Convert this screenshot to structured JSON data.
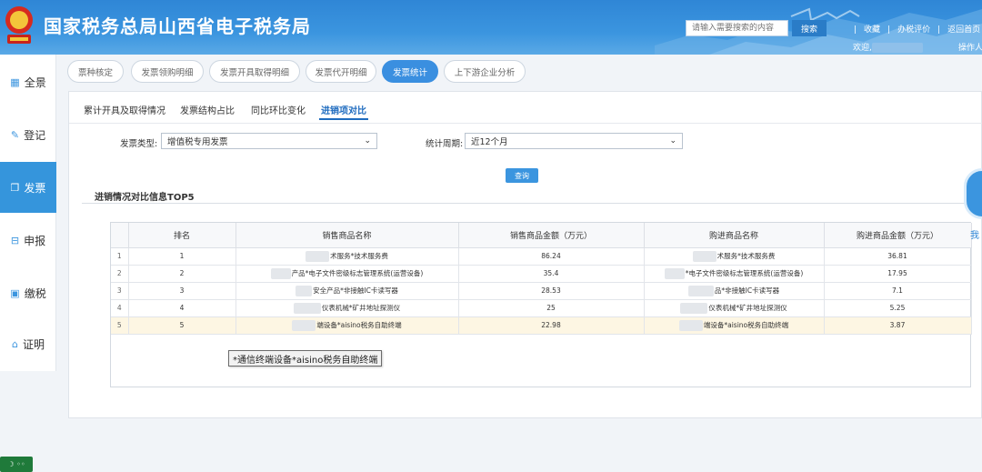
{
  "header": {
    "title": "国家税务总局山西省电子税务局",
    "search_placeholder": "请输入需要搜索的内容",
    "search_button": "搜索",
    "links": [
      "收藏",
      "办税评价",
      "返回首页"
    ],
    "welcome": "欢迎,",
    "operator": "操作人"
  },
  "sidebar": {
    "items": [
      {
        "label": "全景",
        "icon": "grid-icon"
      },
      {
        "label": "登记",
        "icon": "edit-icon"
      },
      {
        "label": "发票",
        "icon": "copy-icon"
      },
      {
        "label": "申报",
        "icon": "declare-icon"
      },
      {
        "label": "缴税",
        "icon": "wallet-icon"
      },
      {
        "label": "证明",
        "icon": "house-icon"
      }
    ],
    "active": "发票"
  },
  "main_tabs": [
    "票种核定",
    "发票领购明细",
    "发票开具取得明细",
    "发票代开明细",
    "发票统计",
    "上下游企业分析"
  ],
  "sub_tabs": [
    "累计开具及取得情况",
    "发票结构占比",
    "同比环比变化",
    "进销项对比"
  ],
  "filters": {
    "invoice_type_label": "发票类型:",
    "invoice_type_value": "增值税专用发票",
    "period_label": "统计周期:",
    "period_value": "近12个月",
    "query_button": "查询"
  },
  "section_title": "进销情况对比信息TOP5",
  "table": {
    "headers": [
      "",
      "排名",
      "销售商品名称",
      "销售商品金额（万元）",
      "购进商品名称",
      "购进商品金额（万元）"
    ],
    "rows": [
      {
        "idx": "1",
        "rank": "1",
        "sale_name": "术服务*技术服务费",
        "sale_amount": "86.24",
        "buy_name": "术服务*技术服务费",
        "buy_amount": "36.81"
      },
      {
        "idx": "2",
        "rank": "2",
        "sale_name": "产品*电子文件密级标志管理系统(运营设备)",
        "sale_amount": "35.4",
        "buy_name": "*电子文件密级标志管理系统(运营设备)",
        "buy_amount": "17.95"
      },
      {
        "idx": "3",
        "rank": "3",
        "sale_name": "安全产品*非接触IC卡读写器",
        "sale_amount": "28.53",
        "buy_name": "品*非接触IC卡读写器",
        "buy_amount": "7.1"
      },
      {
        "idx": "4",
        "rank": "4",
        "sale_name": "仪表机械*矿井地址探测仪",
        "sale_amount": "25",
        "buy_name": "仪表机械*矿井地址探测仪",
        "buy_amount": "5.25"
      },
      {
        "idx": "5",
        "rank": "5",
        "sale_name": "端设备*aisino税务自助终端",
        "sale_amount": "22.98",
        "buy_name": "端设备*aisino税务自助终端",
        "buy_amount": "3.87"
      }
    ],
    "highlighted_row": 5
  },
  "tooltip": "*通信终端设备*aisino税务自助终端",
  "float_label": "我",
  "status_chip": "☽ ◦◦",
  "colors": {
    "header": "#2f86d6",
    "active": "#3a8fe0",
    "highlight_row": "#fdf6e3"
  }
}
